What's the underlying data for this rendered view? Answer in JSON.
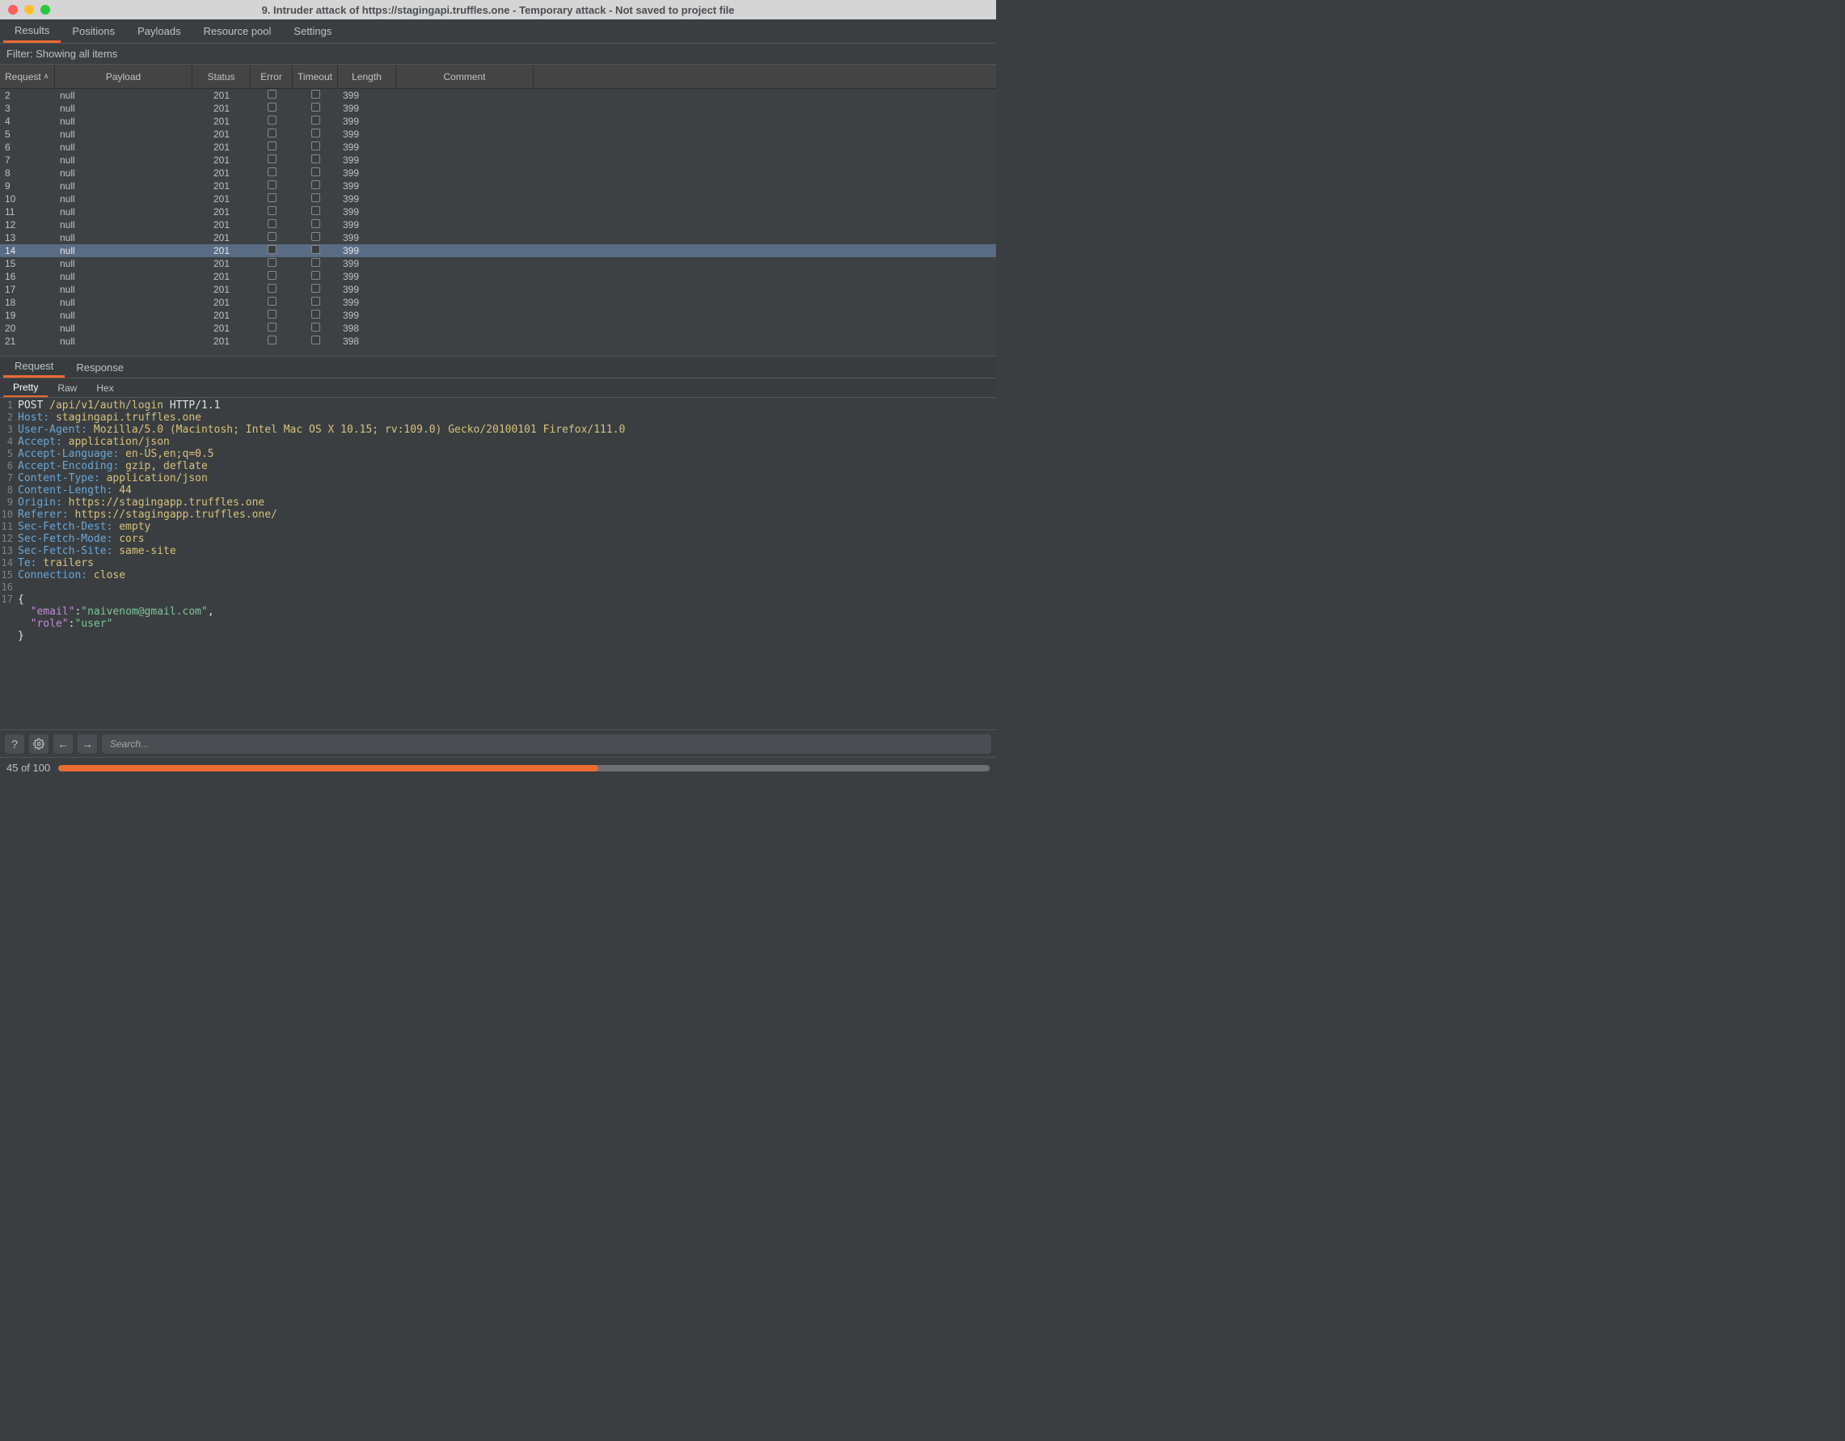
{
  "window_title": "9. Intruder attack of https://stagingapi.truffles.one - Temporary attack - Not saved to project file",
  "main_tabs": [
    "Results",
    "Positions",
    "Payloads",
    "Resource pool",
    "Settings"
  ],
  "active_main_tab": 0,
  "filter_text": "Filter: Showing all items",
  "columns": [
    "Request",
    "Payload",
    "Status",
    "Error",
    "Timeout",
    "Length",
    "Comment"
  ],
  "sort_column": 0,
  "sort_dir": "asc",
  "rows": [
    {
      "request": "2",
      "payload": "null",
      "status": "201",
      "length": "399"
    },
    {
      "request": "3",
      "payload": "null",
      "status": "201",
      "length": "399"
    },
    {
      "request": "4",
      "payload": "null",
      "status": "201",
      "length": "399"
    },
    {
      "request": "5",
      "payload": "null",
      "status": "201",
      "length": "399"
    },
    {
      "request": "6",
      "payload": "null",
      "status": "201",
      "length": "399"
    },
    {
      "request": "7",
      "payload": "null",
      "status": "201",
      "length": "399"
    },
    {
      "request": "8",
      "payload": "null",
      "status": "201",
      "length": "399"
    },
    {
      "request": "9",
      "payload": "null",
      "status": "201",
      "length": "399"
    },
    {
      "request": "10",
      "payload": "null",
      "status": "201",
      "length": "399"
    },
    {
      "request": "11",
      "payload": "null",
      "status": "201",
      "length": "399"
    },
    {
      "request": "12",
      "payload": "null",
      "status": "201",
      "length": "399"
    },
    {
      "request": "13",
      "payload": "null",
      "status": "201",
      "length": "399"
    },
    {
      "request": "14",
      "payload": "null",
      "status": "201",
      "length": "399",
      "selected": true
    },
    {
      "request": "15",
      "payload": "null",
      "status": "201",
      "length": "399"
    },
    {
      "request": "16",
      "payload": "null",
      "status": "201",
      "length": "399"
    },
    {
      "request": "17",
      "payload": "null",
      "status": "201",
      "length": "399"
    },
    {
      "request": "18",
      "payload": "null",
      "status": "201",
      "length": "399"
    },
    {
      "request": "19",
      "payload": "null",
      "status": "201",
      "length": "399"
    },
    {
      "request": "20",
      "payload": "null",
      "status": "201",
      "length": "398"
    },
    {
      "request": "21",
      "payload": "null",
      "status": "201",
      "length": "398"
    }
  ],
  "reqres_tabs": [
    "Request",
    "Response"
  ],
  "active_reqres_tab": 0,
  "view_tabs": [
    "Pretty",
    "Raw",
    "Hex"
  ],
  "active_view_tab": 0,
  "request_lines": [
    {
      "n": "1",
      "html": "<span class=\"jm\">POST</span> <span class=\"hv\">/api/v1/auth/login</span> <span class=\"jm\">HTTP/1.1</span>"
    },
    {
      "n": "2",
      "html": "<span class=\"hk\">Host:</span> <span class=\"hv\">stagingapi.truffles.one</span>"
    },
    {
      "n": "3",
      "html": "<span class=\"hk\">User-Agent:</span> <span class=\"hv\">Mozilla/5.0 (Macintosh; Intel Mac OS X 10.15; rv:109.0) Gecko/20100101 Firefox/111.0</span>"
    },
    {
      "n": "4",
      "html": "<span class=\"hk\">Accept:</span> <span class=\"hv\">application/json</span>"
    },
    {
      "n": "5",
      "html": "<span class=\"hk\">Accept-Language:</span> <span class=\"hv\">en-US,en;q=0.5</span>"
    },
    {
      "n": "6",
      "html": "<span class=\"hk\">Accept-Encoding:</span> <span class=\"hv\">gzip, deflate</span>"
    },
    {
      "n": "7",
      "html": "<span class=\"hk\">Content-Type:</span> <span class=\"hv\">application/json</span>"
    },
    {
      "n": "8",
      "html": "<span class=\"hk\">Content-Length:</span> <span class=\"hv\">44</span>"
    },
    {
      "n": "9",
      "html": "<span class=\"hk\">Origin:</span> <span class=\"hv\">https://stagingapp.truffles.one</span>"
    },
    {
      "n": "10",
      "html": "<span class=\"hk\">Referer:</span> <span class=\"hv\">https://stagingapp.truffles.one/</span>"
    },
    {
      "n": "11",
      "html": "<span class=\"hk\">Sec-Fetch-Dest:</span> <span class=\"hv\">empty</span>"
    },
    {
      "n": "12",
      "html": "<span class=\"hk\">Sec-Fetch-Mode:</span> <span class=\"hv\">cors</span>"
    },
    {
      "n": "13",
      "html": "<span class=\"hk\">Sec-Fetch-Site:</span> <span class=\"hv\">same-site</span>"
    },
    {
      "n": "14",
      "html": "<span class=\"hk\">Te:</span> <span class=\"hv\">trailers</span>"
    },
    {
      "n": "15",
      "html": "<span class=\"hk\">Connection:</span> <span class=\"hv\">close</span>"
    },
    {
      "n": "16",
      "html": ""
    },
    {
      "n": "17",
      "html": "<span class=\"jm\">{</span>"
    },
    {
      "n": "",
      "html": "  <span class=\"js-k\">\"email\"</span><span class=\"jm\">:</span><span class=\"js-v\">\"naivenom@gmail.com\"</span><span class=\"jm\">,</span>"
    },
    {
      "n": "",
      "html": "  <span class=\"js-k\">\"role\"</span><span class=\"jm\">:</span><span class=\"js-v\">\"user\"</span>"
    },
    {
      "n": "",
      "html": "<span class=\"jm\">}</span>"
    }
  ],
  "search_placeholder": "Search...",
  "progress": {
    "label": "45 of 100",
    "percent": 58
  }
}
